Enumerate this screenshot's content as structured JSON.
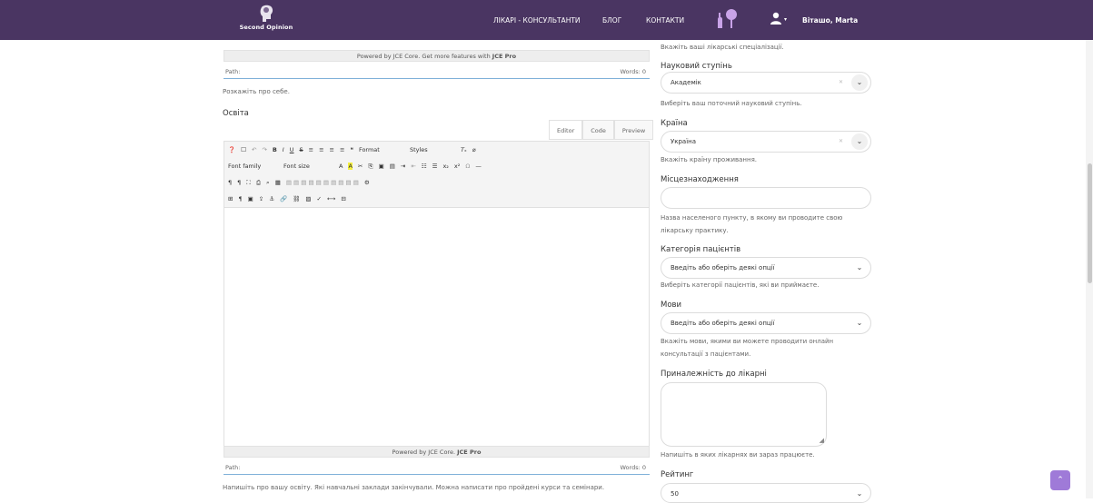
{
  "header": {
    "logo_text": "Second Opinion",
    "nav": [
      "ЛІКАРІ - КОНСУЛЬТАНТИ",
      "БЛОГ",
      "КОНТАКТИ"
    ],
    "username": "Віташо, Marta",
    "colors": {
      "topbar": "#4a3562",
      "accent": "#9f7ad8"
    }
  },
  "editor1": {
    "powered_by": "Powered by JCE Core. Get more features with",
    "powered_by_pro": "JCE Pro",
    "path_label": "Path:",
    "words": "Words: 0",
    "help": "Розкажіть про себе."
  },
  "education": {
    "label": "Освіта",
    "tabs": [
      "Editor",
      "Code",
      "Preview"
    ],
    "toolbar": {
      "format": "Format",
      "styles": "Styles",
      "font_family": "Font family",
      "font_size": "Font size"
    },
    "powered_by": "Powered by JCE Core.",
    "powered_by_pro": "JCE Pro",
    "path_label": "Path:",
    "words": "Words: 0",
    "help": "Напишіть про вашу освіту. Які навчальні заклади закінчували. Можна написати про пройдені курси та семінари."
  },
  "sidebar": {
    "specializations_help": "Вкажіть ваші лікарські спеціалізації.",
    "degree": {
      "label": "Науковий ступінь",
      "value": "Академік",
      "help": "Виберіть ваш поточний науковий ступінь."
    },
    "country": {
      "label": "Країна",
      "value": "Україна",
      "help": "Вкажіть країну проживання."
    },
    "location": {
      "label": "Місцезнаходження",
      "value": "",
      "help_line1": "Назва населеного пункту, в якому ви проводите свою",
      "help_line2": "лікарську практику."
    },
    "patients": {
      "label": "Категорія пацієнтів",
      "placeholder": "Введіть або оберіть деякі опції",
      "help": "Виберіть категорії пацієнтів, які ви приймаєте."
    },
    "languages": {
      "label": "Мови",
      "placeholder": "Введіть або оберіть деякі опції",
      "help_line1": "Вкажіть мови, якими ви можете проводити онлайн",
      "help_line2": "консультації з пацієнтами."
    },
    "hospital": {
      "label": "Приналежність до лікарні",
      "value": "",
      "help": "Напишіть в яких лікарнях ви зараз працюєте."
    },
    "rating": {
      "label": "Рейтинг",
      "value": "50"
    }
  }
}
